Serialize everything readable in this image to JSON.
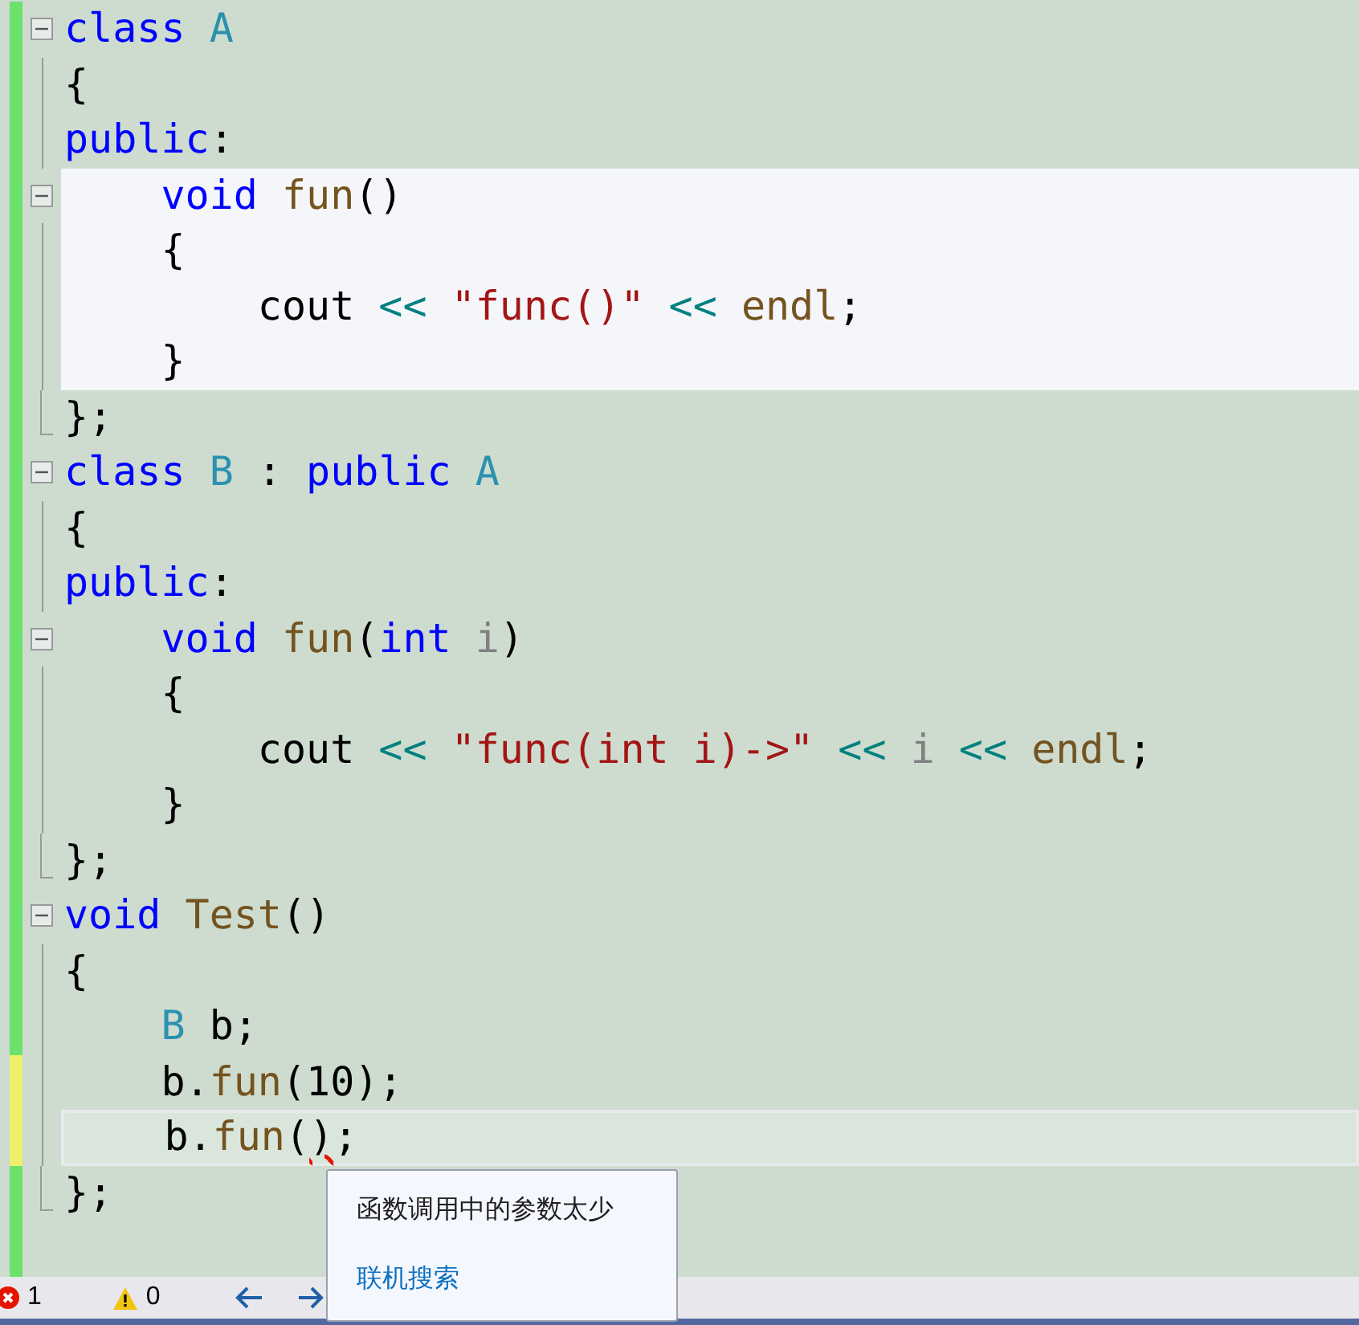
{
  "editor": {
    "lines": [
      {
        "collapsible": true,
        "block_end": false,
        "modified": false,
        "highlight": false,
        "current": false,
        "tokens": [
          {
            "kind": "keyword",
            "text": "class"
          },
          {
            "kind": "type",
            "text": " A"
          }
        ]
      },
      {
        "collapsible": false,
        "block_end": false,
        "modified": false,
        "highlight": false,
        "current": false,
        "tokens": [
          {
            "kind": "plain",
            "text": "{"
          }
        ]
      },
      {
        "collapsible": false,
        "block_end": false,
        "modified": false,
        "highlight": false,
        "current": false,
        "tokens": [
          {
            "kind": "keyword",
            "text": "public"
          },
          {
            "kind": "plain",
            "text": ":"
          }
        ]
      },
      {
        "collapsible": true,
        "block_end": false,
        "modified": false,
        "highlight": true,
        "current": false,
        "tokens": [
          {
            "kind": "keyword",
            "text": "    void"
          },
          {
            "kind": "func",
            "text": " fun"
          },
          {
            "kind": "plain",
            "text": "()"
          }
        ]
      },
      {
        "collapsible": false,
        "block_end": false,
        "modified": false,
        "highlight": true,
        "current": false,
        "tokens": [
          {
            "kind": "plain",
            "text": "    {"
          }
        ]
      },
      {
        "collapsible": false,
        "block_end": false,
        "modified": false,
        "highlight": true,
        "current": false,
        "tokens": [
          {
            "kind": "plain",
            "text": "        cout"
          },
          {
            "kind": "op",
            "text": " <<"
          },
          {
            "kind": "string",
            "text": " \"func()\""
          },
          {
            "kind": "op",
            "text": " <<"
          },
          {
            "kind": "func",
            "text": " endl"
          },
          {
            "kind": "plain",
            "text": ";"
          }
        ]
      },
      {
        "collapsible": false,
        "block_end": false,
        "modified": false,
        "highlight": true,
        "current": false,
        "tokens": [
          {
            "kind": "plain",
            "text": "    }"
          }
        ]
      },
      {
        "collapsible": false,
        "block_end": true,
        "modified": false,
        "highlight": false,
        "current": false,
        "tokens": [
          {
            "kind": "plain",
            "text": "};"
          }
        ]
      },
      {
        "collapsible": true,
        "block_end": false,
        "modified": false,
        "highlight": false,
        "current": false,
        "tokens": [
          {
            "kind": "keyword",
            "text": "class"
          },
          {
            "kind": "type",
            "text": " B"
          },
          {
            "kind": "plain",
            "text": " :"
          },
          {
            "kind": "keyword",
            "text": " public"
          },
          {
            "kind": "type",
            "text": " A"
          }
        ]
      },
      {
        "collapsible": false,
        "block_end": false,
        "modified": false,
        "highlight": false,
        "current": false,
        "tokens": [
          {
            "kind": "plain",
            "text": "{"
          }
        ]
      },
      {
        "collapsible": false,
        "block_end": false,
        "modified": false,
        "highlight": false,
        "current": false,
        "tokens": [
          {
            "kind": "keyword",
            "text": "public"
          },
          {
            "kind": "plain",
            "text": ":"
          }
        ]
      },
      {
        "collapsible": true,
        "block_end": false,
        "modified": false,
        "highlight": false,
        "current": false,
        "tokens": [
          {
            "kind": "keyword",
            "text": "    void"
          },
          {
            "kind": "func",
            "text": " fun"
          },
          {
            "kind": "plain",
            "text": "("
          },
          {
            "kind": "keyword",
            "text": "int"
          },
          {
            "kind": "param",
            "text": " i"
          },
          {
            "kind": "plain",
            "text": ")"
          }
        ]
      },
      {
        "collapsible": false,
        "block_end": false,
        "modified": false,
        "highlight": false,
        "current": false,
        "tokens": [
          {
            "kind": "plain",
            "text": "    {"
          }
        ]
      },
      {
        "collapsible": false,
        "block_end": false,
        "modified": false,
        "highlight": false,
        "current": false,
        "tokens": [
          {
            "kind": "plain",
            "text": "        cout"
          },
          {
            "kind": "op",
            "text": " <<"
          },
          {
            "kind": "string",
            "text": " \"func(int i)->\""
          },
          {
            "kind": "op",
            "text": " <<"
          },
          {
            "kind": "param",
            "text": " i"
          },
          {
            "kind": "op",
            "text": " <<"
          },
          {
            "kind": "func",
            "text": " endl"
          },
          {
            "kind": "plain",
            "text": ";"
          }
        ]
      },
      {
        "collapsible": false,
        "block_end": false,
        "modified": false,
        "highlight": false,
        "current": false,
        "tokens": [
          {
            "kind": "plain",
            "text": "    }"
          }
        ]
      },
      {
        "collapsible": false,
        "block_end": true,
        "modified": false,
        "highlight": false,
        "current": false,
        "tokens": [
          {
            "kind": "plain",
            "text": "};"
          }
        ]
      },
      {
        "collapsible": true,
        "block_end": false,
        "modified": false,
        "highlight": false,
        "current": false,
        "tokens": [
          {
            "kind": "keyword",
            "text": "void"
          },
          {
            "kind": "func",
            "text": " Test"
          },
          {
            "kind": "plain",
            "text": "()"
          }
        ]
      },
      {
        "collapsible": false,
        "block_end": false,
        "modified": false,
        "highlight": false,
        "current": false,
        "tokens": [
          {
            "kind": "plain",
            "text": "{"
          }
        ]
      },
      {
        "collapsible": false,
        "block_end": false,
        "modified": false,
        "highlight": false,
        "current": false,
        "tokens": [
          {
            "kind": "type",
            "text": "    B"
          },
          {
            "kind": "plain",
            "text": " b;"
          }
        ]
      },
      {
        "collapsible": false,
        "block_end": false,
        "modified": true,
        "highlight": false,
        "current": false,
        "tokens": [
          {
            "kind": "plain",
            "text": "    b."
          },
          {
            "kind": "func",
            "text": "fun"
          },
          {
            "kind": "plain",
            "text": "(10);"
          }
        ]
      },
      {
        "collapsible": false,
        "block_end": false,
        "modified": true,
        "highlight": false,
        "current": true,
        "tokens": [
          {
            "kind": "plain",
            "text": "    b."
          },
          {
            "kind": "func",
            "text": "fun"
          },
          {
            "kind": "plain",
            "text": "("
          },
          {
            "kind": "error",
            "text": ")"
          },
          {
            "kind": "plain",
            "text": ";"
          }
        ]
      },
      {
        "collapsible": false,
        "block_end": true,
        "modified": false,
        "highlight": false,
        "current": false,
        "tokens": [
          {
            "kind": "plain",
            "text": "};"
          }
        ]
      }
    ]
  },
  "tooltip": {
    "message": "函数调用中的参数太少",
    "link": "联机搜索"
  },
  "status_bar": {
    "errors": "1",
    "warnings": "0"
  }
}
